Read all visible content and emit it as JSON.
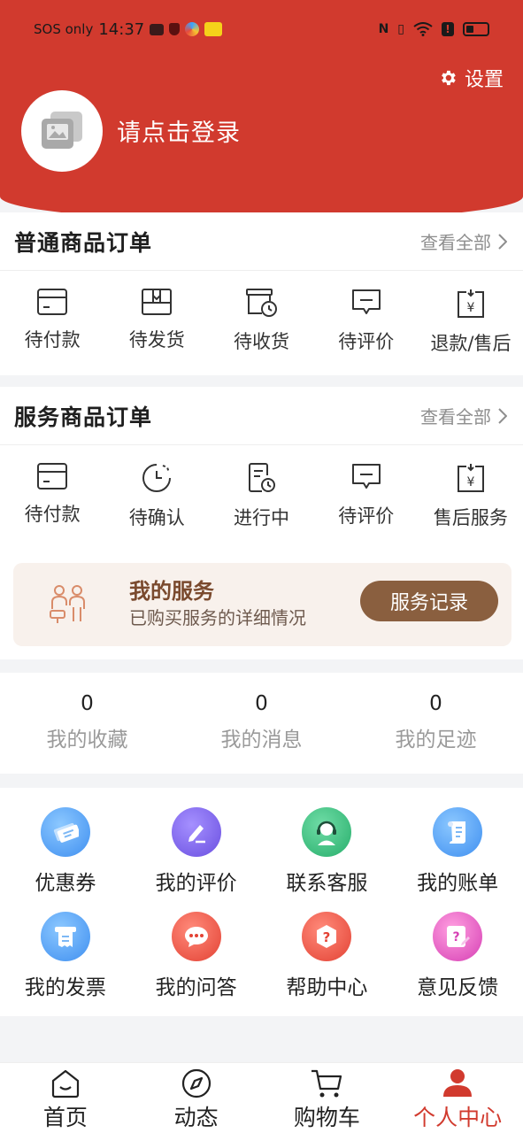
{
  "status_bar": {
    "carrier": "SOS only",
    "time": "14:37"
  },
  "header": {
    "settings_label": "设置",
    "login_prompt": "请点击登录"
  },
  "normal_orders": {
    "title": "普通商品订单",
    "view_all": "查看全部",
    "items": [
      {
        "label": "待付款",
        "icon": "card-icon"
      },
      {
        "label": "待发货",
        "icon": "box-icon"
      },
      {
        "label": "待收货",
        "icon": "delivery-clock-icon"
      },
      {
        "label": "待评价",
        "icon": "comment-icon"
      },
      {
        "label": "退款/售后",
        "icon": "refund-icon"
      }
    ]
  },
  "service_orders": {
    "title": "服务商品订单",
    "view_all": "查看全部",
    "items": [
      {
        "label": "待付款",
        "icon": "card-icon"
      },
      {
        "label": "待确认",
        "icon": "clock-icon"
      },
      {
        "label": "进行中",
        "icon": "document-clock-icon"
      },
      {
        "label": "待评价",
        "icon": "comment-icon"
      },
      {
        "label": "售后服务",
        "icon": "refund-icon"
      }
    ]
  },
  "my_service": {
    "title": "我的服务",
    "subtitle": "已购买服务的详细情况",
    "button": "服务记录"
  },
  "stats": [
    {
      "value": "0",
      "label": "我的收藏"
    },
    {
      "value": "0",
      "label": "我的消息"
    },
    {
      "value": "0",
      "label": "我的足迹"
    }
  ],
  "tools": [
    {
      "label": "优惠券",
      "icon": "coupon-icon"
    },
    {
      "label": "我的评价",
      "icon": "edit-icon"
    },
    {
      "label": "联系客服",
      "icon": "support-icon"
    },
    {
      "label": "我的账单",
      "icon": "bill-icon"
    },
    {
      "label": "我的发票",
      "icon": "invoice-icon"
    },
    {
      "label": "我的问答",
      "icon": "chat-icon"
    },
    {
      "label": "帮助中心",
      "icon": "help-icon"
    },
    {
      "label": "意见反馈",
      "icon": "feedback-icon"
    }
  ],
  "bottom_nav": [
    {
      "label": "首页",
      "icon": "home-icon"
    },
    {
      "label": "动态",
      "icon": "compass-icon"
    },
    {
      "label": "购物车",
      "icon": "cart-icon"
    },
    {
      "label": "个人中心",
      "icon": "user-icon",
      "active": true
    }
  ],
  "colors": {
    "brand_red": "#d13a2e",
    "service_brown": "#8a5f3f"
  }
}
